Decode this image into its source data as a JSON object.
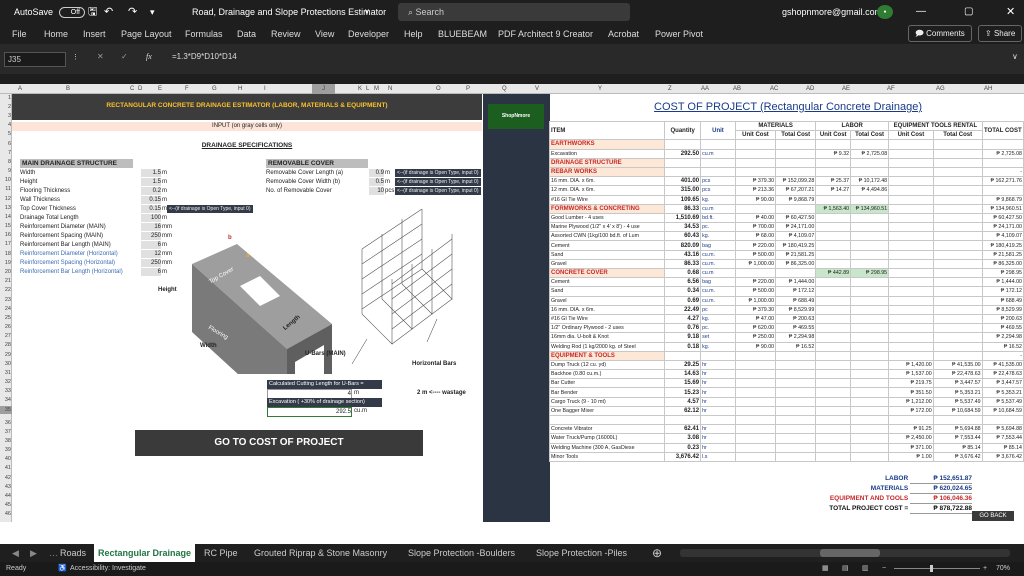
{
  "titlebar": {
    "autosave": "AutoSave",
    "toggle": "Off",
    "doc_title": "Road, Drainage and Slope Protections Estimator",
    "search": "Search",
    "account": "gshopnmore@gmail.com"
  },
  "ribbon": {
    "tabs": [
      "File",
      "Home",
      "Insert",
      "Page Layout",
      "Formulas",
      "Data",
      "Review",
      "View",
      "Developer",
      "Help",
      "BLUEBEAM",
      "PDF Architect 9 Creator",
      "Acrobat",
      "Power Pivot"
    ],
    "comments": "Comments",
    "share": "Share"
  },
  "formula": {
    "cell": "J35",
    "fx": "fx",
    "content": "=1.3*D9*D10*D14"
  },
  "columns": [
    "A",
    "B",
    "C",
    "D",
    "E",
    "F",
    "G",
    "H",
    "I",
    "J",
    "K",
    "L",
    "M",
    "N",
    "O",
    "P",
    "Q",
    "V",
    "Y",
    "Z",
    "AA",
    "AB",
    "AC",
    "AD",
    "AE",
    "AF",
    "AG",
    "AH"
  ],
  "left": {
    "title": "RECTANGULAR CONCRETE DRAINAGE ESTIMATOR (LABOR, MATERIALS & EQUIPMENT)",
    "input_note": "INPUT (on gray cells only)",
    "spec_title": "DRAINAGE SPECIFICATIONS",
    "main_title": "MAIN DRAINAGE STRUCTURE",
    "cover_title": "REMOVABLE COVER",
    "main_rows": [
      {
        "label": "Width",
        "value": "1.5",
        "unit": "m"
      },
      {
        "label": "Height",
        "value": "1.5",
        "unit": "m"
      },
      {
        "label": "Flooring Thickness",
        "value": "0.2",
        "unit": "m"
      },
      {
        "label": "Wall Thickness",
        "value": "0.15",
        "unit": "m"
      },
      {
        "label": "Top Cover Thickness",
        "value": "0.15",
        "unit": "m"
      },
      {
        "label": "Drainage Total Length",
        "value": "100",
        "unit": "m"
      },
      {
        "label": "Reinforcement Diameter (MAIN)",
        "value": "16",
        "unit": "mm"
      },
      {
        "label": "Reinforcement Spacing (MAIN)",
        "value": "250",
        "unit": "mm"
      },
      {
        "label": "Reinforcement Bar Length (MAIN)",
        "value": "6",
        "unit": "m"
      },
      {
        "label": "Reinforcement Diameter (Horizontal)",
        "value": "12",
        "unit": "mm"
      },
      {
        "label": "Reinforcement Spacing (Horizontal)",
        "value": "250",
        "unit": "mm"
      },
      {
        "label": "Reinforcement Bar Length (Horizontal)",
        "value": "6",
        "unit": "m"
      }
    ],
    "cover_rows": [
      {
        "label": "Removable Cover Length (a)",
        "value": "0.9",
        "unit": "m",
        "note": "<--(if drainage is Open Type, input 0)"
      },
      {
        "label": "Removable Cover Width (b)",
        "value": "0.5",
        "unit": "m",
        "note": "<--(if drainage is Open Type, input 0)"
      },
      {
        "label": "No. of Removable Cover",
        "value": "10",
        "unit": "pcs",
        "note": "<--(if drainage is Open Type, input 0)"
      }
    ],
    "topcover_note": "<--(if drainage is Open Type, input 0)",
    "diagram": {
      "height": "Height",
      "width": "Width",
      "length": "Length",
      "top_cover": "Top Cover",
      "flooring": "Flooring",
      "a": "a",
      "b": "b",
      "ubars": "U-Bars (MAIN)",
      "hbars": "Horizontal Bars"
    },
    "calc": {
      "label": "Calculated Cutting Length for U-Bars =",
      "value": "4",
      "unit": "m",
      "wastage": "2 m <---- wastage",
      "exc_label": "Excavation ( +30% of drainage section)",
      "exc_value": "292.5",
      "exc_unit": "cu.m"
    },
    "button": "GO TO COST OF PROJECT",
    "logo": "ShopNmore"
  },
  "right": {
    "title": "COST OF PROJECT (Rectangular Concrete Drainage)",
    "headers": {
      "item": "ITEM",
      "qty": "Quantity",
      "unit": "Unit",
      "materials": "MATERIALS",
      "labor": "LABOR",
      "equip": "EQUIPMENT TOOLS RENTAL",
      "total": "TOTAL COST",
      "unit_cost": "Unit Cost",
      "total_cost": "Total Cost"
    },
    "rows": [
      {
        "cat": "EARTHWORKS"
      },
      {
        "item": "Excavation",
        "qty": "292.50",
        "unit": "cu.m",
        "lu": "9.32",
        "lt": "2,725.08",
        "tot": "2,725.08"
      },
      {
        "cat": "DRAINAGE STRUCTURE"
      },
      {
        "cat": "REBAR WORKS",
        "tot": "-"
      },
      {
        "item": "16 mm. DIA. x 6m.",
        "qty": "401.00",
        "unit": "pcs",
        "mu": "379.30",
        "mt": "152,099.28",
        "lu": "25.37",
        "lt": "10,172.48",
        "tot": "162,271.76"
      },
      {
        "item": "12 mm. DIA. x 6m.",
        "qty": "315.00",
        "unit": "pcs",
        "mu": "213.36",
        "mt": "67,207.21",
        "lu": "14.27",
        "lt": "4,494.86",
        "tot": ""
      },
      {
        "item": "#16 GI Tie Wire",
        "qty": "109.65",
        "unit": "kg.",
        "mu": "90.00",
        "mt": "9,868.79",
        "tot": "9,868.79"
      },
      {
        "cat": "FORMWORKS & CONCRETING",
        "qty": "86.33",
        "unit": "cu.m",
        "lu": "1,563.40",
        "lt": "134,960.51",
        "tot": "134,960.51",
        "green": true
      },
      {
        "item": "Good Lumber - 4 uses",
        "qty": "1,510.69",
        "unit": "bd.ft.",
        "mu": "40.00",
        "mt": "60,427.50",
        "tot": "60,427.50"
      },
      {
        "item": "Marine Plywood (1/2\" x 4' x 8') - 4 use",
        "qty": "34.53",
        "unit": "pc.",
        "mu": "700.00",
        "mt": "24,171.00",
        "tot": "24,171.00"
      },
      {
        "item": "Assorted CWN (1kg/100 bd.ft. of Lum",
        "qty": "60.43",
        "unit": "kg.",
        "mu": "68.00",
        "mt": "4,109.07",
        "tot": "4,109.07"
      },
      {
        "item": "Cement",
        "qty": "820.09",
        "unit": "bag",
        "mu": "220.00",
        "mt": "180,419.25",
        "tot": "180,419.25"
      },
      {
        "item": "Sand",
        "qty": "43.16",
        "unit": "cu.m.",
        "mu": "500.00",
        "mt": "21,581.25",
        "tot": "21,581.25"
      },
      {
        "item": "Gravel",
        "qty": "86.33",
        "unit": "cu.m.",
        "mu": "1,000.00",
        "mt": "86,325.00",
        "tot": "86,325.00"
      },
      {
        "cat": "CONCRETE COVER",
        "qty": "0.68",
        "unit": "cu.m",
        "lu": "442.89",
        "lt": "298.95",
        "tot": "298.95",
        "green": true
      },
      {
        "item": "Cement",
        "qty": "6.56",
        "unit": "bag",
        "mu": "220.00",
        "mt": "1,444.00",
        "tot": "1,444.00"
      },
      {
        "item": "Sand",
        "qty": "0.34",
        "unit": "cu.m.",
        "mu": "500.00",
        "mt": "172.12",
        "tot": "172.12"
      },
      {
        "item": "Gravel",
        "qty": "0.69",
        "unit": "cu.m.",
        "mu": "1,000.00",
        "mt": "688.49",
        "tot": "688.49"
      },
      {
        "item": "16 mm. DIA. x 6m.",
        "qty": "22.49",
        "unit": "pc",
        "mu": "379.30",
        "mt": "8,529.99",
        "tot": "8,529.99"
      },
      {
        "item": "#16 GI Tie Wire",
        "qty": "4.27",
        "unit": "kg.",
        "mu": "47.00",
        "mt": "200.63",
        "tot": "200.63"
      },
      {
        "item": "1/2\" Ordinary Plywood - 2 uses",
        "qty": "0.76",
        "unit": "pc.",
        "mu": "620.00",
        "mt": "469.55",
        "tot": "469.55"
      },
      {
        "item": "16mm dia. U-bolt & Knot",
        "qty": "9.18",
        "unit": "set",
        "mu": "250.00",
        "mt": "2,294.98",
        "tot": "2,294.98"
      },
      {
        "item": "Welding Rod (1 kg/2000 kg. of Steel",
        "qty": "0.18",
        "unit": "kg.",
        "mu": "90.00",
        "mt": "16.52",
        "tot": "16.52"
      },
      {
        "cat": "EQUIPMENT & TOOLS",
        "tot": "-"
      },
      {
        "item": "Dump Truck (12 cu. yd)",
        "qty": "29.25",
        "unit": "hr",
        "eu": "1,420.00",
        "et": "41,535.00",
        "tot": "41,535.00"
      },
      {
        "item": "Backhoe (0.80 cu.m.)",
        "qty": "14.63",
        "unit": "hr",
        "eu": "1,537.00",
        "et": "22,478.63",
        "tot": "22,478.63"
      },
      {
        "item": "Bar Cutter",
        "qty": "15.69",
        "unit": "hr",
        "eu": "219.75",
        "et": "3,447.57",
        "tot": "3,447.57"
      },
      {
        "item": "Bar Bender",
        "qty": "15.23",
        "unit": "hr",
        "eu": "351.50",
        "et": "5,353.21",
        "tot": "5,353.21"
      },
      {
        "item": "Cargo Truck (9 - 10 mt)",
        "qty": "4.57",
        "unit": "hr",
        "eu": "1,212.00",
        "et": "5,537.49",
        "tot": "5,537.49"
      },
      {
        "item": "One Bagger Mixer",
        "qty": "62.12",
        "unit": "hr",
        "eu": "172.00",
        "et": "10,684.59",
        "tot": "10,684.59"
      },
      {
        "item": ""
      },
      {
        "item": "Concrete Vibrator",
        "qty": "62.41",
        "unit": "hr",
        "eu": "91.25",
        "et": "5,694.88",
        "tot": "5,694.88"
      },
      {
        "item": "Water Truck/Pump (16000L)",
        "qty": "3.08",
        "unit": "hr",
        "eu": "2,450.00",
        "et": "7,553.44",
        "tot": "7,553.44"
      },
      {
        "item": "Welding Machine (300 A, GasDiese",
        "qty": "0.23",
        "unit": "hr",
        "eu": "371.00",
        "et": "85.14",
        "tot": "85.14"
      },
      {
        "item": "Minor Tools",
        "qty": "3,676.42",
        "unit": "l.s",
        "eu": "1.00",
        "et": "3,676.42",
        "tot": "3,676.42"
      }
    ],
    "peso": "₱",
    "summary": [
      {
        "label": "LABOR",
        "value": "152,651.87"
      },
      {
        "label": "MATERIALS",
        "value": "620,024.65"
      },
      {
        "label": "EQUIPMENT AND TOOLS",
        "value": "106,046.36"
      },
      {
        "label": "TOTAL PROJECT COST =",
        "value": "878,722.88"
      }
    ],
    "go_back": "GO BACK"
  },
  "sheets": [
    "Roads",
    "Rectangular Drainage",
    "RC Pipe",
    "Grouted Riprap & Stone Masonry",
    "Slope Protection -Boulders",
    "Slope Protection -Piles"
  ],
  "status": {
    "ready": "Ready",
    "access": "Accessibility: Investigate",
    "zoom": "70%"
  },
  "colors": {
    "dark": "#1e1e1e",
    "excel_green": "#217346",
    "cat_red": "#c62828",
    "input_gray": "#d9d9d9",
    "button": "#3a3a3a"
  }
}
